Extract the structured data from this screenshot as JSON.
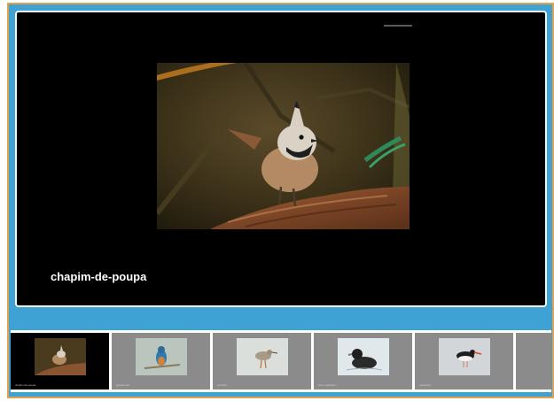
{
  "viewer": {
    "caption": "chapim-de-poupa"
  },
  "thumbnails": [
    {
      "label": "chapim-de-poupa",
      "active": true,
      "icon": "bird-photo-crested-tit"
    },
    {
      "label": "guarda-rios",
      "active": false,
      "icon": "bird-photo-kingfisher"
    },
    {
      "label": "borrelho",
      "active": false,
      "icon": "bird-photo-wader"
    },
    {
      "label": "zarro-negrinha",
      "active": false,
      "icon": "bird-photo-duck"
    },
    {
      "label": "ostraceiro",
      "active": false,
      "icon": "bird-photo-oystercatcher"
    },
    {
      "label": "",
      "active": false,
      "icon": "bird-photo-partial"
    }
  ],
  "colors": {
    "frame": "#3fa2d4",
    "frame_border": "#e4a14a",
    "viewer_bg": "#000000",
    "thumb_bg": "#8b8b8b"
  }
}
